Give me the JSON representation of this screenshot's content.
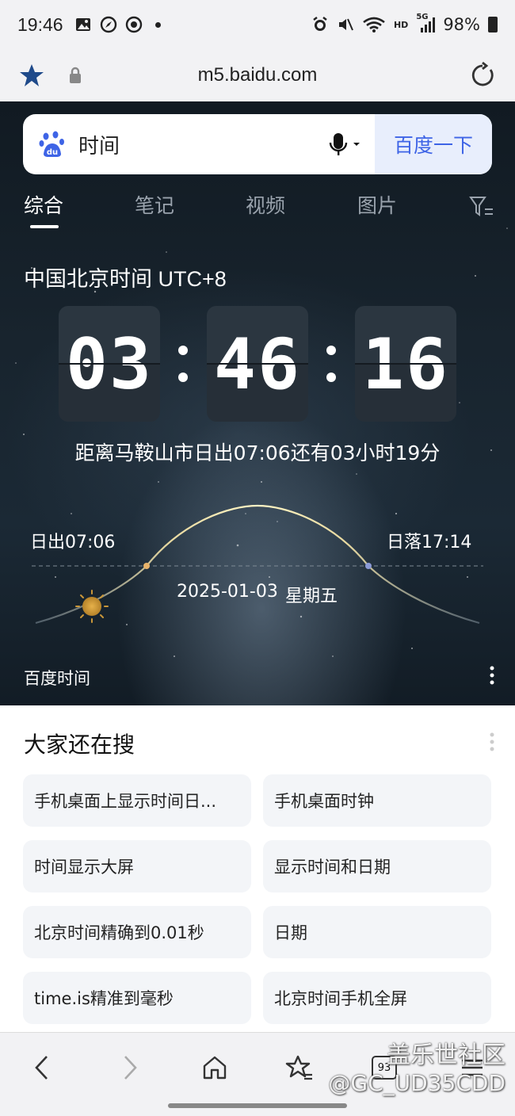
{
  "status_bar": {
    "time": "19:46",
    "battery": "98%",
    "network": "5G",
    "hd": "HD"
  },
  "browser": {
    "url": "m5.baidu.com"
  },
  "search": {
    "query": "时间",
    "submit_label": "百度一下"
  },
  "tabs": [
    {
      "label": "综合",
      "active": true
    },
    {
      "label": "笔记",
      "active": false
    },
    {
      "label": "视频",
      "active": false
    },
    {
      "label": "图片",
      "active": false
    }
  ],
  "clock": {
    "timezone_title": "中国北京时间 UTC+8",
    "hours": "03",
    "minutes": "46",
    "seconds": "16",
    "sunrise_note": "距离马鞍山市日出07:06还有03小时19分",
    "sunrise_label": "日出07:06",
    "sunset_label": "日落17:14",
    "date": "2025-01-03",
    "weekday": "星期五",
    "source": "百度时间"
  },
  "related": {
    "title": "大家还在搜",
    "items": [
      "手机桌面上显示时间日...",
      "手机桌面时钟",
      "时间显示大屏",
      "显示时间和日期",
      "北京时间精确到0.01秒",
      "日期",
      "time.is精准到毫秒",
      "北京时间手机全屏"
    ]
  },
  "bottom_nav": {
    "tab_count": "93"
  },
  "watermark": {
    "line1": "盖乐世社区",
    "line2": "@GC_UD35CDD"
  },
  "colors": {
    "accent": "#3e64e6",
    "hero_bg": "#18242e",
    "sun": "#d9a441"
  }
}
